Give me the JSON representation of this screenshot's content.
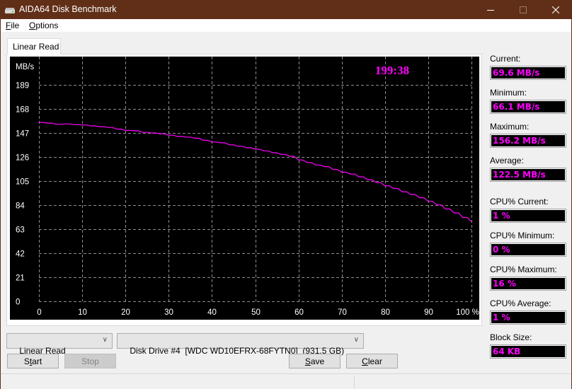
{
  "window": {
    "title": "AIDA64 Disk Benchmark",
    "controls": {
      "minimize": "minimize",
      "maximize": "maximize",
      "close": "close"
    }
  },
  "menu": {
    "items": [
      {
        "label": "File",
        "accel": "F",
        "rest": "ile"
      },
      {
        "label": "Options",
        "accel": "O",
        "rest": "ptions"
      }
    ]
  },
  "tabs": [
    {
      "label": "Linear Read",
      "active": true
    }
  ],
  "timer": "199:38",
  "colors": {
    "line": "#ff00ff",
    "grid": "#8c8c8c",
    "chart_bg": "#000000",
    "axis_text": "#ffffff",
    "value_text": "#ff00ff",
    "titlebar": "#612f17"
  },
  "stats": [
    {
      "label": "Current:",
      "value": "69.6 MB/s"
    },
    {
      "label": "Minimum:",
      "value": "66.1 MB/s"
    },
    {
      "label": "Maximum:",
      "value": "156.2 MB/s"
    },
    {
      "label": "Average:",
      "value": "122.5 MB/s"
    },
    {
      "label": "CPU% Current:",
      "value": "1 %"
    },
    {
      "label": "CPU% Minimum:",
      "value": "0 %"
    },
    {
      "label": "CPU% Maximum:",
      "value": "16 %"
    },
    {
      "label": "CPU% Average:",
      "value": "1 %"
    },
    {
      "label": "Block Size:",
      "value": "64 KB"
    }
  ],
  "controls": {
    "test_select": "Linear Read",
    "drive_select": "Disk Drive #4  [WDC WD10EFRX-68FYTN0]  (931.5 GB)",
    "start": {
      "label": "Start",
      "accel_index": 1
    },
    "stop": {
      "label": "Stop",
      "disabled": true
    },
    "save": {
      "label": "Save",
      "accel_index": 0
    },
    "clear": {
      "label": "Clear",
      "accel_index": 0
    }
  },
  "status": {
    "left": "",
    "right": ""
  },
  "chart_data": {
    "type": "line",
    "title": "",
    "ylabel": "MB/s",
    "xlabel": "%",
    "ylim": [
      0,
      210
    ],
    "xlim": [
      0,
      100
    ],
    "yticks": [
      0,
      21,
      42,
      63,
      84,
      105,
      126,
      147,
      168,
      189
    ],
    "xticks": [
      0,
      10,
      20,
      30,
      40,
      50,
      60,
      70,
      80,
      90,
      100
    ],
    "xtick_labels": [
      "0",
      "10",
      "20",
      "30",
      "40",
      "50",
      "60",
      "70",
      "80",
      "90",
      "100 %"
    ],
    "grid": true,
    "series": [
      {
        "name": "Linear Read",
        "x": [
          0,
          2,
          4,
          6,
          8,
          10,
          12,
          14,
          16,
          18,
          20,
          22,
          24,
          26,
          28,
          30,
          32,
          34,
          36,
          38,
          40,
          42,
          44,
          46,
          48,
          50,
          52,
          54,
          56,
          58,
          60,
          62,
          64,
          66,
          68,
          70,
          72,
          74,
          76,
          78,
          80,
          82,
          84,
          86,
          88,
          90,
          92,
          94,
          96,
          98,
          100
        ],
        "values": [
          156.2,
          155.6,
          154.6,
          154.9,
          154.3,
          154.0,
          153.2,
          152.5,
          151.8,
          150.4,
          149.2,
          148.9,
          147.5,
          147.0,
          146.3,
          145.1,
          144.0,
          143.4,
          142.4,
          140.6,
          139.1,
          138.4,
          136.6,
          135.4,
          134.1,
          132.8,
          131.4,
          129.7,
          128.2,
          126.6,
          123.4,
          121.2,
          119.0,
          117.6,
          115.1,
          112.7,
          111.1,
          108.7,
          106.2,
          103.6,
          100.9,
          98.5,
          95.7,
          93.2,
          90.5,
          87.2,
          84.2,
          80.6,
          77.2,
          73.2,
          69.6
        ]
      }
    ]
  }
}
